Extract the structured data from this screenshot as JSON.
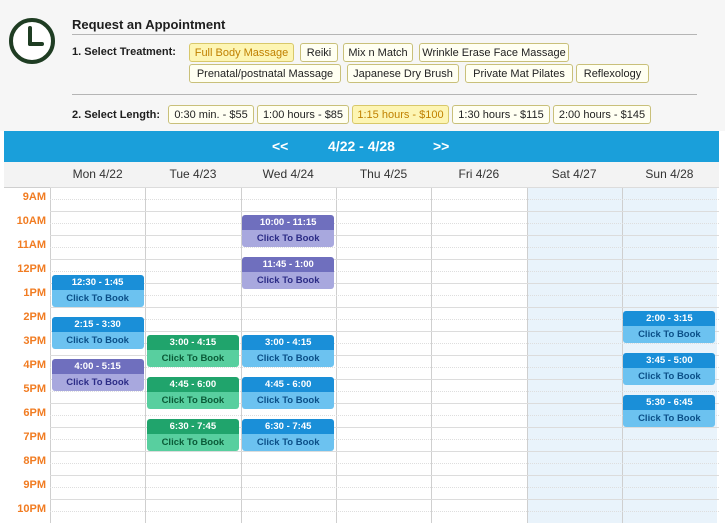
{
  "header": {
    "title": "Request an Appointment"
  },
  "treatment": {
    "label": "1. Select Treatment:",
    "options": [
      "Full Body Massage",
      "Reiki",
      "Mix n Match",
      "Wrinkle Erase Face Massage",
      "Prenatal/postnatal Massage",
      "Japanese Dry Brush",
      "Private Mat Pilates",
      "Reflexology"
    ],
    "selected": "Full Body Massage"
  },
  "length": {
    "label": "2. Select Length:",
    "options": [
      "0:30 min. - $55",
      "1:00 hours - $85",
      "1:15 hours - $100",
      "1:30 hours - $115",
      "2:00 hours - $145"
    ],
    "selected": "1:15 hours - $100"
  },
  "calendar": {
    "prev": "<<",
    "next": ">>",
    "range": "4/22 - 4/28",
    "days": [
      "Mon 4/22",
      "Tue 4/23",
      "Wed 4/24",
      "Thu 4/25",
      "Fri 4/26",
      "Sat 4/27",
      "Sun 4/28"
    ],
    "hours": [
      "9AM",
      "10AM",
      "11AM",
      "12PM",
      "1PM",
      "2PM",
      "3PM",
      "4PM",
      "5PM",
      "6PM",
      "7PM",
      "8PM",
      "9PM",
      "10PM"
    ],
    "book_label": "Click To Book",
    "slots": [
      {
        "day": 0,
        "start": 12.5,
        "time": "12:30 - 1:45",
        "color": "blue"
      },
      {
        "day": 0,
        "start": 14.25,
        "time": "2:15 - 3:30",
        "color": "blue"
      },
      {
        "day": 0,
        "start": 16,
        "time": "4:00 - 5:15",
        "color": "purple"
      },
      {
        "day": 1,
        "start": 15,
        "time": "3:00 - 4:15",
        "color": "green"
      },
      {
        "day": 1,
        "start": 16.75,
        "time": "4:45 - 6:00",
        "color": "green"
      },
      {
        "day": 1,
        "start": 18.5,
        "time": "6:30 - 7:45",
        "color": "green"
      },
      {
        "day": 2,
        "start": 10,
        "time": "10:00 - 11:15",
        "color": "purple"
      },
      {
        "day": 2,
        "start": 11.75,
        "time": "11:45 - 1:00",
        "color": "purple"
      },
      {
        "day": 2,
        "start": 15,
        "time": "3:00 - 4:15",
        "color": "blue"
      },
      {
        "day": 2,
        "start": 16.75,
        "time": "4:45 - 6:00",
        "color": "blue"
      },
      {
        "day": 2,
        "start": 18.5,
        "time": "6:30 - 7:45",
        "color": "blue"
      },
      {
        "day": 6,
        "start": 14,
        "time": "2:00 - 3:15",
        "color": "blue"
      },
      {
        "day": 6,
        "start": 15.75,
        "time": "3:45 - 5:00",
        "color": "blue"
      },
      {
        "day": 6,
        "start": 17.5,
        "time": "5:30 - 6:45",
        "color": "blue"
      }
    ]
  },
  "colors": {
    "accent": "#1a9fda",
    "hour_label": "#f17c22",
    "weekend": "#e9f3fb",
    "selected_chip": "#fdf5b3"
  },
  "icons": {
    "logo": "clock-icon"
  }
}
